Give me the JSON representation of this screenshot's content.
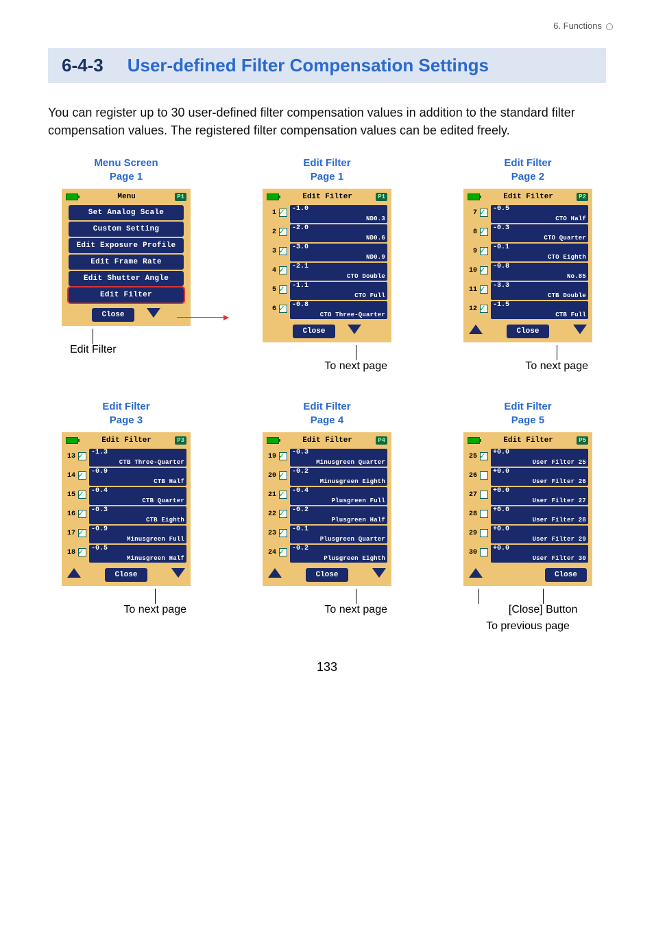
{
  "header": {
    "breadcrumb": "6.  Functions"
  },
  "section": {
    "number": "6-4-3",
    "title": "User-defined Filter Compensation Settings"
  },
  "body": "You can register up to 30 user-defined filter compensation values in addition to the standard filter compensation values. The registered filter compensation values can be edited freely.",
  "panels": [
    {
      "caption": "Menu Screen\nPage 1",
      "screen_title": "Menu",
      "page_tag": "P1",
      "menu_items": [
        "Set Analog Scale",
        "Custom Setting",
        "Edit Exposure Profile",
        "Edit Frame Rate",
        "Edit Shutter Angle",
        "Edit Filter"
      ],
      "highlight_index": 5,
      "nav": "close_down",
      "callout_left": "Edit Filter",
      "callout_right": "",
      "has_arrow": true
    },
    {
      "caption": "Edit Filter\nPage 1",
      "screen_title": "Edit Filter",
      "page_tag": "P1",
      "rows": [
        {
          "n": "1",
          "chk": true,
          "val": "-1.0",
          "name": "ND0.3"
        },
        {
          "n": "2",
          "chk": true,
          "val": "-2.0",
          "name": "ND0.6"
        },
        {
          "n": "3",
          "chk": true,
          "val": "-3.0",
          "name": "ND0.9"
        },
        {
          "n": "4",
          "chk": true,
          "val": "-2.1",
          "name": "CTO Double"
        },
        {
          "n": "5",
          "chk": true,
          "val": "-1.1",
          "name": "CTO Full"
        },
        {
          "n": "6",
          "chk": true,
          "val": "-0.8",
          "name": "CTO Three-Quarter"
        }
      ],
      "nav": "close_down",
      "callout_right": "To next page"
    },
    {
      "caption": "Edit Filter\nPage 2",
      "screen_title": "Edit Filter",
      "page_tag": "P2",
      "rows": [
        {
          "n": "7",
          "chk": true,
          "val": "-0.5",
          "name": "CTO Half"
        },
        {
          "n": "8",
          "chk": true,
          "val": "-0.3",
          "name": "CTO Quarter"
        },
        {
          "n": "9",
          "chk": true,
          "val": "-0.1",
          "name": "CTO Eighth"
        },
        {
          "n": "10",
          "chk": true,
          "val": "-0.8",
          "name": "No.85"
        },
        {
          "n": "11",
          "chk": true,
          "val": "-3.3",
          "name": "CTB Double"
        },
        {
          "n": "12",
          "chk": true,
          "val": "-1.5",
          "name": "CTB Full"
        }
      ],
      "nav": "up_close_down",
      "callout_right": "To next page"
    },
    {
      "caption": "Edit Filter\nPage 3",
      "screen_title": "Edit Filter",
      "page_tag": "P3",
      "rows": [
        {
          "n": "13",
          "chk": true,
          "val": "-1.3",
          "name": "CTB Three-Quarter"
        },
        {
          "n": "14",
          "chk": true,
          "val": "-0.9",
          "name": "CTB Half"
        },
        {
          "n": "15",
          "chk": true,
          "val": "-0.4",
          "name": "CTB Quarter"
        },
        {
          "n": "16",
          "chk": true,
          "val": "-0.3",
          "name": "CTB Eighth"
        },
        {
          "n": "17",
          "chk": true,
          "val": "-0.9",
          "name": "Minusgreen Full"
        },
        {
          "n": "18",
          "chk": true,
          "val": "-0.5",
          "name": "Minusgreen Half"
        }
      ],
      "nav": "up_close_down",
      "callout_right": "To next page"
    },
    {
      "caption": "Edit Filter\nPage 4",
      "screen_title": "Edit Filter",
      "page_tag": "P4",
      "rows": [
        {
          "n": "19",
          "chk": true,
          "val": "-0.3",
          "name": "Minusgreen Quarter"
        },
        {
          "n": "20",
          "chk": true,
          "val": "-0.2",
          "name": "Minusgreen Eighth"
        },
        {
          "n": "21",
          "chk": true,
          "val": "-0.4",
          "name": "Plusgreen Full"
        },
        {
          "n": "22",
          "chk": true,
          "val": "-0.2",
          "name": "Plusgreen Half"
        },
        {
          "n": "23",
          "chk": true,
          "val": "-0.1",
          "name": "Plusgreen Quarter"
        },
        {
          "n": "24",
          "chk": true,
          "val": "-0.2",
          "name": "Plusgreen Eighth"
        }
      ],
      "nav": "up_close_down",
      "callout_right": "To next page"
    },
    {
      "caption": "Edit Filter\nPage 5",
      "screen_title": "Edit Filter",
      "page_tag": "P5",
      "rows": [
        {
          "n": "25",
          "chk": true,
          "val": "+0.0",
          "name": "User Filter 25"
        },
        {
          "n": "26",
          "chk": false,
          "val": "+0.0",
          "name": "User Filter 26"
        },
        {
          "n": "27",
          "chk": false,
          "val": "+0.0",
          "name": "User Filter 27"
        },
        {
          "n": "28",
          "chk": false,
          "val": "+0.0",
          "name": "User Filter 28"
        },
        {
          "n": "29",
          "chk": false,
          "val": "+0.0",
          "name": "User Filter 29"
        },
        {
          "n": "30",
          "chk": false,
          "val": "+0.0",
          "name": "User Filter 30"
        }
      ],
      "nav": "up_close",
      "callout_left_nav": "To previous page",
      "callout_right": "[Close] Button"
    }
  ],
  "close_label": "Close",
  "prev_page_caption": "To previous page",
  "page_number": "133"
}
